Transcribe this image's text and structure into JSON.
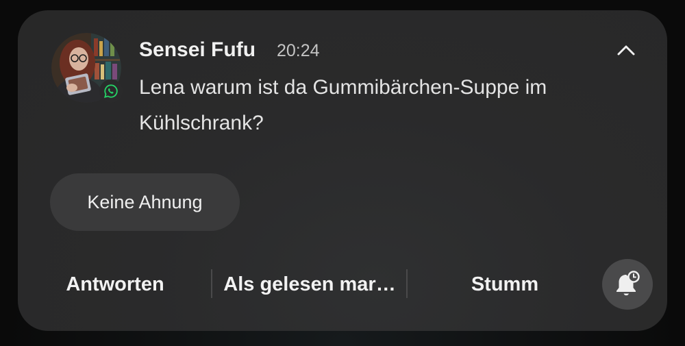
{
  "notification": {
    "sender": "Sensei Fufu",
    "time": "20:24",
    "message": "Lena warum ist da Gummibärchen-Suppe im Kühlschrank?",
    "app_badge_icon": "whatsapp-icon",
    "collapse_icon": "chevron-up-icon"
  },
  "quick_replies": [
    {
      "label": "Keine Ahnung"
    }
  ],
  "actions": {
    "reply_label": "Antworten",
    "mark_read_label": "Als gelesen mar…",
    "mute_label": "Stumm",
    "snooze_icon": "bell-snooze-icon"
  },
  "colors": {
    "card_background": "#2a2a2b",
    "quick_reply_background": "#3a3a3b",
    "snooze_button_background": "#4a4a4b",
    "whatsapp_green": "#25d366",
    "text_primary": "#f0f0f0",
    "text_secondary": "#c4c4c4"
  }
}
